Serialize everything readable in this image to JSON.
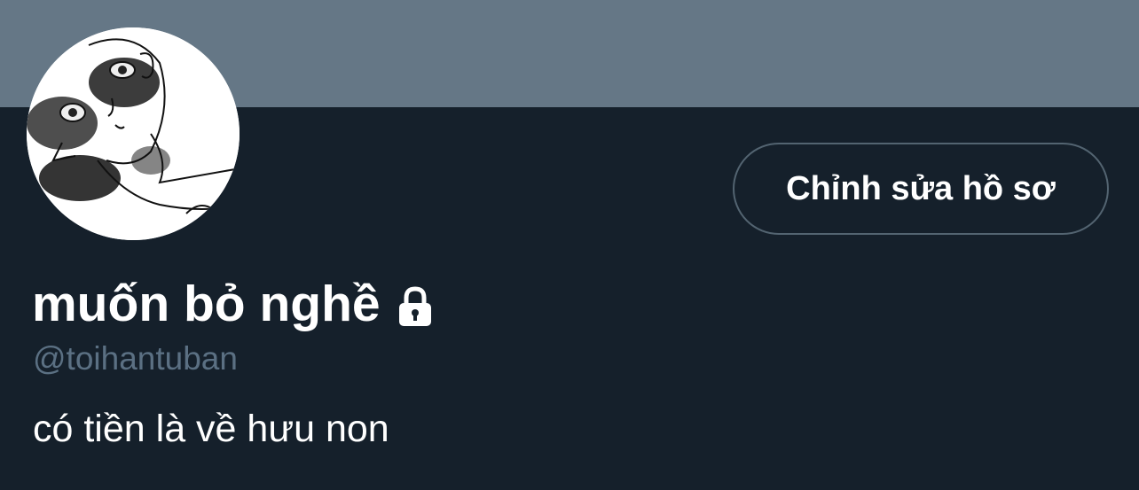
{
  "profile": {
    "display_name": "muốn bỏ nghề",
    "handle": "@toihantuban",
    "bio": "có tiền là về hưu non",
    "protected_icon": "lock-icon",
    "avatar_icon": "sketch-portrait-avatar"
  },
  "actions": {
    "edit_profile_label": "Chỉnh sửa hồ sơ"
  },
  "colors": {
    "banner": "#657786",
    "background": "#15202b",
    "handle_text": "#5b7083",
    "button_border": "#536471",
    "primary_text": "#ffffff"
  }
}
